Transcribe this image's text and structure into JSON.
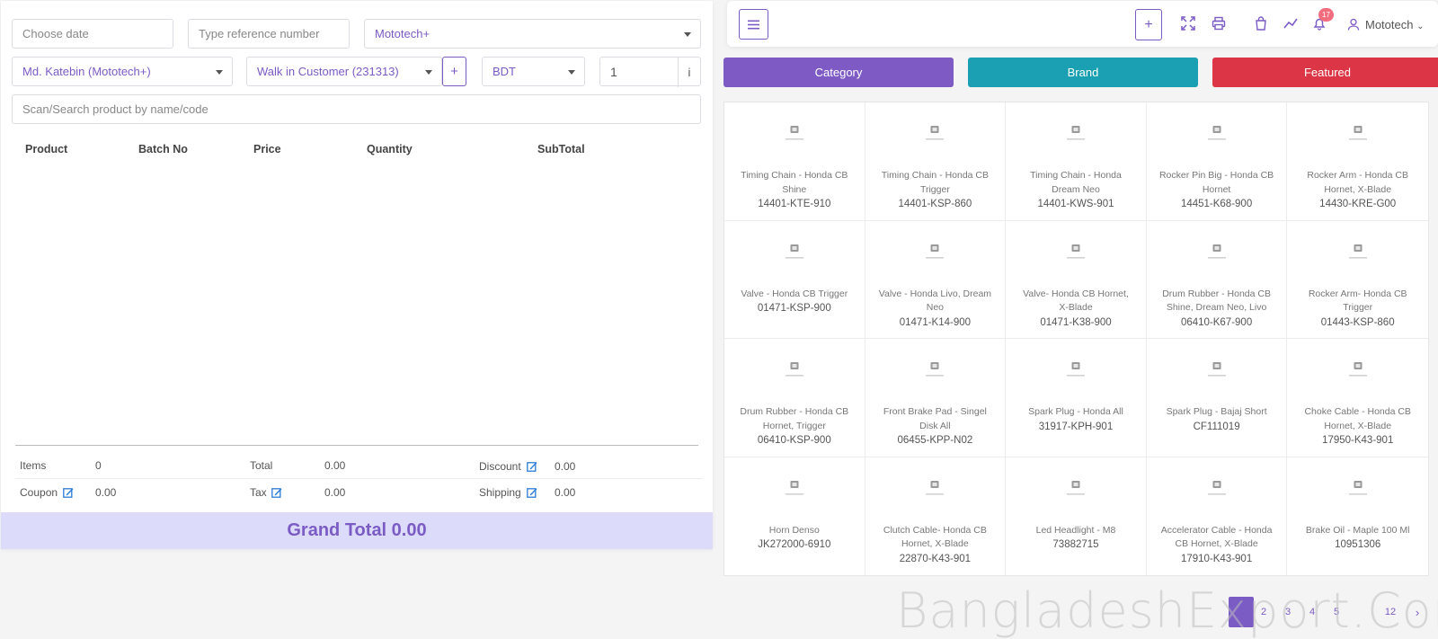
{
  "pos_form": {
    "date_placeholder": "Choose date",
    "reference_placeholder": "Type reference number",
    "warehouse_value": "Mototech+",
    "biller_value": "Md. Katebin (Mototech+)",
    "customer_value": "Walk in Customer (231313)",
    "add_customer_label": "+",
    "currency_value": "BDT",
    "quantity_value": "1",
    "info_label": "i",
    "search_placeholder": "Scan/Search product by name/code"
  },
  "table": {
    "headers": [
      "Product",
      "Batch No",
      "Price",
      "Quantity",
      "SubTotal"
    ]
  },
  "summary": {
    "items_label": "Items",
    "items_value": "0",
    "total_label": "Total",
    "total_value": "0.00",
    "discount_label": "Discount",
    "discount_value": "0.00",
    "coupon_label": "Coupon",
    "coupon_value": "0.00",
    "tax_label": "Tax",
    "tax_value": "0.00",
    "shipping_label": "Shipping",
    "shipping_value": "0.00",
    "grand_total": "Grand Total 0.00"
  },
  "topbar": {
    "add_label": "+",
    "notification_count": "17",
    "user_name": "Mototech"
  },
  "tabs": {
    "category": "Category",
    "brand": "Brand",
    "featured": "Featured"
  },
  "colors": {
    "accent": "#7b5bc4",
    "category_bg": "#7e5bc4",
    "brand_bg": "#1ba0b3",
    "featured_bg": "#dc3545",
    "grand_total_bg": "#dcdcfa"
  },
  "products": [
    {
      "name": "Timing Chain - Honda CB Shine",
      "code": "14401-KTE-910"
    },
    {
      "name": "Timing Chain - Honda CB Trigger",
      "code": "14401-KSP-860"
    },
    {
      "name": "Timing Chain - Honda Dream Neo",
      "code": "14401-KWS-901"
    },
    {
      "name": "Rocker Pin Big - Honda CB Hornet",
      "code": "14451-K68-900"
    },
    {
      "name": "Rocker Arm - Honda CB Hornet, X-Blade",
      "code": "14430-KRE-G00"
    },
    {
      "name": "Valve - Honda CB Trigger",
      "code": "01471-KSP-900"
    },
    {
      "name": "Valve - Honda Livo, Dream Neo",
      "code": "01471-K14-900"
    },
    {
      "name": "Valve- Honda CB Hornet, X-Blade",
      "code": "01471-K38-900"
    },
    {
      "name": "Drum Rubber - Honda CB Shine, Dream Neo, Livo",
      "code": "06410-K67-900"
    },
    {
      "name": "Rocker Arm- Honda CB Trigger",
      "code": "01443-KSP-860"
    },
    {
      "name": "Drum Rubber - Honda CB Hornet, Trigger",
      "code": "06410-KSP-900"
    },
    {
      "name": "Front Brake Pad - Singel Disk All",
      "code": "06455-KPP-N02"
    },
    {
      "name": "Spark Plug - Honda All",
      "code": "31917-KPH-901"
    },
    {
      "name": "Spark Plug - Bajaj Short",
      "code": "CF111019"
    },
    {
      "name": "Choke Cable - Honda CB Hornet, X-Blade",
      "code": "17950-K43-901"
    },
    {
      "name": "Horn Denso",
      "code": "JK272000-6910"
    },
    {
      "name": "Clutch Cable- Honda CB Hornet, X-Blade",
      "code": "22870-K43-901"
    },
    {
      "name": "Led Headlight - M8",
      "code": "73882715"
    },
    {
      "name": "Accelerator Cable - Honda CB Hornet, X-Blade",
      "code": "17910-K43-901"
    },
    {
      "name": "Brake Oil - Maple 100 Ml",
      "code": "10951306"
    }
  ],
  "pagination": {
    "pages": [
      "2",
      "3",
      "4",
      "5",
      "12",
      "›"
    ]
  },
  "watermark": "BangladeshExport.Com"
}
